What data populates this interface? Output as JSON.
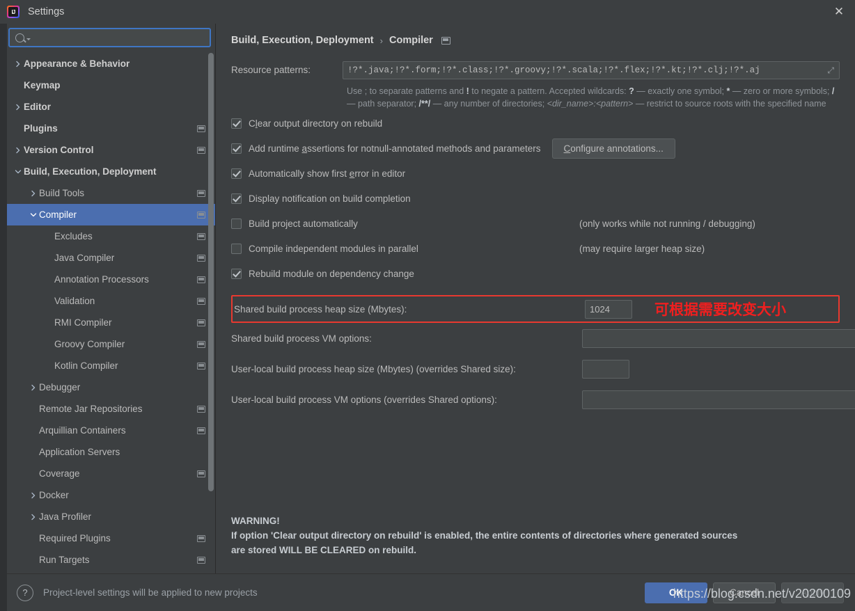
{
  "window": {
    "title": "Settings",
    "close_label": "✕",
    "logo_name": "intellij-idea-logo"
  },
  "sidebar": {
    "search": {
      "value": "",
      "placeholder": ""
    },
    "items": [
      {
        "label": "Appearance & Behavior",
        "arrow": "right",
        "indent": 0,
        "bold": true,
        "copy": false,
        "selected": false
      },
      {
        "label": "Keymap",
        "arrow": "none",
        "indent": 0,
        "bold": true,
        "copy": false,
        "selected": false
      },
      {
        "label": "Editor",
        "arrow": "right",
        "indent": 0,
        "bold": true,
        "copy": false,
        "selected": false
      },
      {
        "label": "Plugins",
        "arrow": "none",
        "indent": 0,
        "bold": true,
        "copy": true,
        "selected": false
      },
      {
        "label": "Version Control",
        "arrow": "right",
        "indent": 0,
        "bold": true,
        "copy": true,
        "selected": false
      },
      {
        "label": "Build, Execution, Deployment",
        "arrow": "down",
        "indent": 0,
        "bold": true,
        "copy": false,
        "selected": false
      },
      {
        "label": "Build Tools",
        "arrow": "right",
        "indent": 1,
        "bold": false,
        "copy": true,
        "selected": false
      },
      {
        "label": "Compiler",
        "arrow": "down",
        "indent": 1,
        "bold": false,
        "copy": true,
        "selected": true
      },
      {
        "label": "Excludes",
        "arrow": "none",
        "indent": 2,
        "bold": false,
        "copy": true,
        "selected": false
      },
      {
        "label": "Java Compiler",
        "arrow": "none",
        "indent": 2,
        "bold": false,
        "copy": true,
        "selected": false
      },
      {
        "label": "Annotation Processors",
        "arrow": "none",
        "indent": 2,
        "bold": false,
        "copy": true,
        "selected": false
      },
      {
        "label": "Validation",
        "arrow": "none",
        "indent": 2,
        "bold": false,
        "copy": true,
        "selected": false
      },
      {
        "label": "RMI Compiler",
        "arrow": "none",
        "indent": 2,
        "bold": false,
        "copy": true,
        "selected": false
      },
      {
        "label": "Groovy Compiler",
        "arrow": "none",
        "indent": 2,
        "bold": false,
        "copy": true,
        "selected": false
      },
      {
        "label": "Kotlin Compiler",
        "arrow": "none",
        "indent": 2,
        "bold": false,
        "copy": true,
        "selected": false
      },
      {
        "label": "Debugger",
        "arrow": "right",
        "indent": 1,
        "bold": false,
        "copy": false,
        "selected": false
      },
      {
        "label": "Remote Jar Repositories",
        "arrow": "none",
        "indent": 1,
        "bold": false,
        "copy": true,
        "selected": false
      },
      {
        "label": "Arquillian Containers",
        "arrow": "none",
        "indent": 1,
        "bold": false,
        "copy": true,
        "selected": false
      },
      {
        "label": "Application Servers",
        "arrow": "none",
        "indent": 1,
        "bold": false,
        "copy": false,
        "selected": false
      },
      {
        "label": "Coverage",
        "arrow": "none",
        "indent": 1,
        "bold": false,
        "copy": true,
        "selected": false
      },
      {
        "label": "Docker",
        "arrow": "right",
        "indent": 1,
        "bold": false,
        "copy": false,
        "selected": false
      },
      {
        "label": "Java Profiler",
        "arrow": "right",
        "indent": 1,
        "bold": false,
        "copy": false,
        "selected": false
      },
      {
        "label": "Required Plugins",
        "arrow": "none",
        "indent": 1,
        "bold": false,
        "copy": true,
        "selected": false
      },
      {
        "label": "Run Targets",
        "arrow": "none",
        "indent": 1,
        "bold": false,
        "copy": true,
        "selected": false
      }
    ]
  },
  "content": {
    "breadcrumb": {
      "root": "Build, Execution, Deployment",
      "separator": "›",
      "leaf": "Compiler"
    },
    "resource_patterns": {
      "label": "Resource patterns:",
      "value": "!?*.java;!?*.form;!?*.class;!?*.groovy;!?*.scala;!?*.flex;!?*.kt;!?*.clj;!?*.aj",
      "expand_icon": "⤢",
      "hint_line1_a": "Use ; to separate patterns and ",
      "hint_bang": "!",
      "hint_line1_b": " to negate a pattern. Accepted wildcards: ",
      "hint_q": "?",
      "hint_line1_c": " — exactly one symbol; ",
      "hint_star": "*",
      "hint_line1_d": " — zero or more symbols; ",
      "hint_slash": "/",
      "hint_line1_e": " — path separator; ",
      "hint_dstar": "/**/",
      "hint_line1_f": " — any number of directories; ",
      "hint_dir": "<dir_name>:<pattern>",
      "hint_line1_g": " — restrict to source roots with the specified name"
    },
    "checkboxes": [
      {
        "label_pre": "C",
        "label_mn": "l",
        "label_post": "ear output directory on rebuild",
        "checked": true,
        "hint": ""
      },
      {
        "label_pre": "Add runtime ",
        "label_mn": "a",
        "label_post": "ssertions for notnull-annotated methods and parameters",
        "checked": true,
        "hint": ""
      },
      {
        "label_pre": "Automatically show first ",
        "label_mn": "e",
        "label_post": "rror in editor",
        "checked": true,
        "hint": ""
      },
      {
        "label_pre": "Display notification on build completion",
        "label_mn": "",
        "label_post": "",
        "checked": true,
        "hint": ""
      },
      {
        "label_pre": "Build project automatically",
        "label_mn": "",
        "label_post": "",
        "checked": false,
        "hint": "(only works while not running / debugging)"
      },
      {
        "label_pre": "Compile independent modules in parallel",
        "label_mn": "",
        "label_post": "",
        "checked": false,
        "hint": "(may require larger heap size)"
      },
      {
        "label_pre": "Rebuild module on dependency change",
        "label_mn": "",
        "label_post": "",
        "checked": true,
        "hint": ""
      }
    ],
    "configure_annotations": {
      "mnemonic": "C",
      "rest": "onfigure annotations..."
    },
    "heap_row": {
      "label": "Shared build process heap size (Mbytes):",
      "value": "1024",
      "annotation": "可根据需要改变大小",
      "highlight_color": "#e8392f",
      "annotation_color": "#f01f1f"
    },
    "fields": [
      {
        "label": "Shared build process VM options:",
        "value": "",
        "width": "wide"
      },
      {
        "label": "User-local build process heap size (Mbytes) (overrides Shared size):",
        "value": "",
        "width": "small"
      },
      {
        "label": "User-local build process VM options (overrides Shared options):",
        "value": "",
        "width": "wide"
      }
    ],
    "warning": {
      "title": "WARNING!",
      "line1": "If option 'Clear output directory on rebuild' is enabled, the entire contents of directories where generated sources",
      "line2": "are stored WILL BE CLEARED on rebuild."
    }
  },
  "footer": {
    "help_glyph": "?",
    "note": "Project-level settings will be applied to new projects",
    "ok": "OK",
    "cancel": "Cancel",
    "apply": "Apply"
  },
  "watermark": "https://blog.csdn.net/v20200109"
}
